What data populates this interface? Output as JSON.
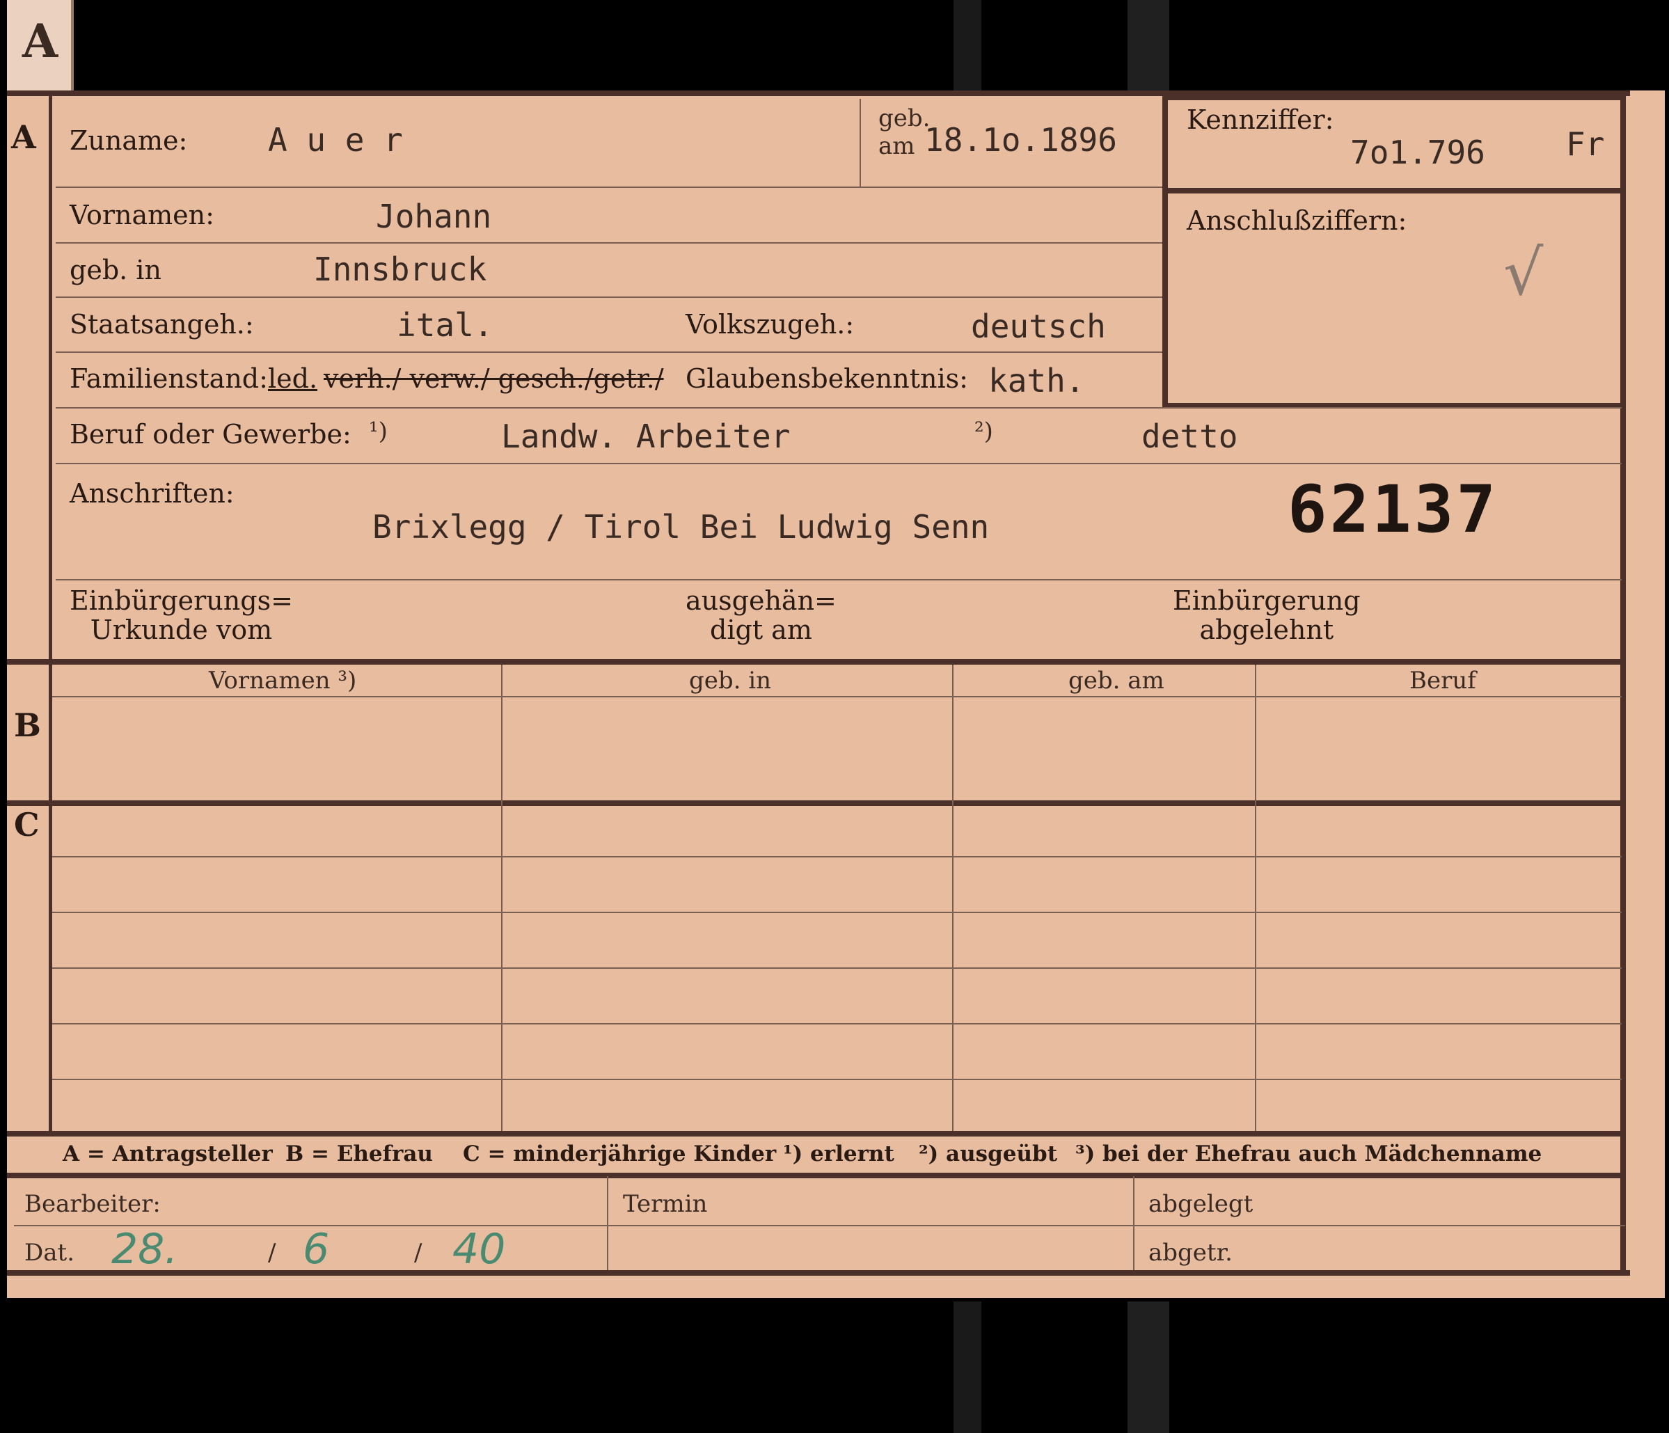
{
  "tab": {
    "letter": "A"
  },
  "sections": {
    "a": "A",
    "b": "B",
    "c": "C"
  },
  "header": {
    "zuname_label": "Zuname:",
    "zuname_value": "A u e r",
    "geb_am_label_1": "geb.",
    "geb_am_label_2": "am",
    "geb_am_value": "18.1o.1896",
    "kennziffer_label": "Kennziffer:",
    "kennziffer_value": "7o1.796",
    "kennziffer_suffix": "Fr",
    "anschluss_label": "Anschlußziffern:",
    "anschluss_mark": "√"
  },
  "person": {
    "vornamen_label": "Vornamen:",
    "vornamen_value": "Johann",
    "geb_in_label": "geb. in",
    "geb_in_value": "Innsbruck",
    "staatsangeh_label": "Staatsangeh.:",
    "staatsangeh_value": "ital.",
    "volkszugeh_label": "Volkszugeh.:",
    "volkszugeh_value": "deutsch",
    "familienstand_label": "Familienstand:",
    "familienstand_led": "led.",
    "familienstand_options": "verh./ verw./ gesch./getr./",
    "glauben_label": "Glaubensbekenntnis:",
    "glauben_value": "kath.",
    "beruf_label": "Beruf oder Gewerbe:",
    "beruf_note1": "¹)",
    "beruf_value1": "Landw. Arbeiter",
    "beruf_note2": "²)",
    "beruf_value2": "detto",
    "anschriften_label": "Anschriften:",
    "anschriften_value": "Brixlegg / Tirol  Bei Ludwig Senn",
    "stamp_number": "62137"
  },
  "einbuergerung": {
    "urkunde_1": "Einbürgerungs=",
    "urkunde_2": "Urkunde vom",
    "ausgehaendigt_1": "ausgehän=",
    "ausgehaendigt_2": "digt am",
    "abgelehnt_1": "Einbürgerung",
    "abgelehnt_2": "abgelehnt"
  },
  "table": {
    "columns": [
      "Vornamen ³)",
      "geb. in",
      "geb. am",
      "Beruf"
    ]
  },
  "legend": {
    "a": "A = Antragsteller",
    "b": "B = Ehefrau",
    "c": "C = minderjährige Kinder",
    "n1": "¹) erlernt",
    "n2": "²) ausgeübt",
    "n3": "³) bei der Ehefrau auch Mädchenname"
  },
  "footer": {
    "bearbeiter_label": "Bearbeiter:",
    "dat_label": "Dat.",
    "dat_day": "28.",
    "dat_sep1": "/",
    "dat_month": "6",
    "dat_sep2": "/",
    "dat_year": "40",
    "termin_label": "Termin",
    "abgelegt_label": "abgelegt",
    "abgetr_label": "abgetr."
  }
}
